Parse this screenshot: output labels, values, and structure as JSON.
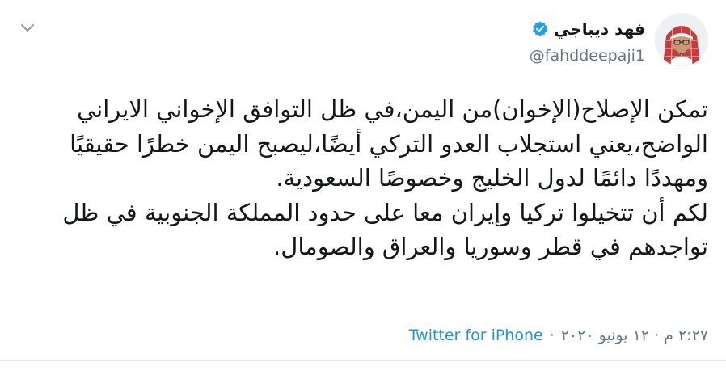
{
  "tweet": {
    "author": {
      "display_name": "فهد ديباجي",
      "handle": "@fahddeepaji1"
    },
    "text": "تمكن الإصلاح(الإخوان)من اليمن،في ظل التوافق الإخواني الايراني الواضح،يعني استجلاب العدو التركي أيضًا،ليصبح اليمن خطرًا حقيقيًا ومهددًا دائمًا لدول الخليج وخصوصًا السعودية.\nلكم أن تتخيلوا تركيا وإيران معا على حدود المملكة الجنوبية في ظل تواجدهم في قطر وسوريا والعراق والصومال.",
    "timestamp": "٢:٢٧ م · ١٢ يونيو ٢٠٢٠",
    "separator": "·",
    "source": "Twitter for iPhone"
  },
  "icons": {
    "verified": "verified-badge-icon",
    "more": "chevron-down-icon"
  },
  "colors": {
    "verified": "#1da1f2",
    "link": "#1b95e0",
    "secondary_text": "#657786",
    "primary_text": "#14171a"
  }
}
